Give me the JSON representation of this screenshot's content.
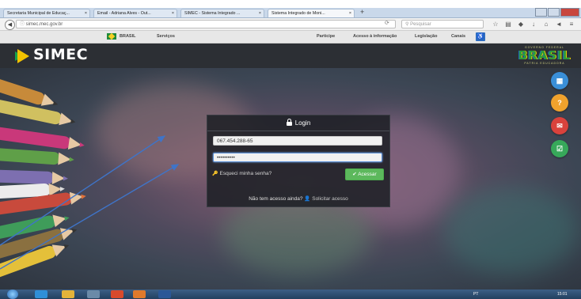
{
  "browser": {
    "tabs": [
      {
        "label": "Secretaria Municipal de Educaç...",
        "close": "×"
      },
      {
        "label": "Email - Adriana Alves - Out...",
        "close": "×"
      },
      {
        "label": "SIMEC - Sistema Integrado ...",
        "close": "×"
      },
      {
        "label": "Sistema Integrado de Moni...",
        "close": "×"
      }
    ],
    "new_tab": "+",
    "url": "simec.mec.gov.br",
    "search_placeholder": "Pesquisar"
  },
  "gov_bar": {
    "brasil": "BRASIL",
    "servicos": "Serviços",
    "links": [
      "Participe",
      "Acesso à informação",
      "Legislação",
      "Canais"
    ]
  },
  "header": {
    "logo_text": "SIMEC",
    "brasil_logo_top": "GOVERNO FEDERAL",
    "brasil_logo_word": "BRASIL",
    "brasil_logo_bottom": "PATRIA EDUCADORA"
  },
  "login": {
    "title": "Login",
    "cpf_value": "067.454.288-65",
    "password_value": "••••••••••",
    "forgot_label": "Esqueci minha senha?",
    "submit_label": "Acessar",
    "no_access_text": "Não tem acesso ainda?",
    "request_access_label": "Solicitar acesso"
  },
  "side_buttons": [
    {
      "name": "apps",
      "color": "#3a8fd8"
    },
    {
      "name": "help",
      "color": "#f0a22d"
    },
    {
      "name": "chat",
      "color": "#d9423c"
    },
    {
      "name": "check",
      "color": "#37a85a"
    }
  ],
  "taskbar": {
    "tray": "PT",
    "time": "15:01"
  }
}
